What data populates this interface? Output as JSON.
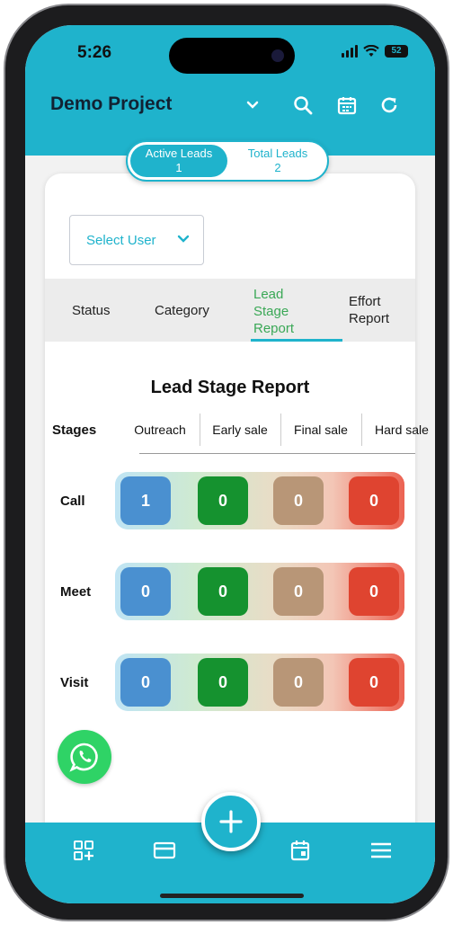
{
  "status_bar": {
    "time": "5:26",
    "battery": "52"
  },
  "header": {
    "title": "Demo Project"
  },
  "lead_toggle": {
    "active": {
      "label": "Active Leads",
      "count": "1"
    },
    "total": {
      "label": "Total Leads",
      "count": "2"
    }
  },
  "user_select": {
    "placeholder": "Select User"
  },
  "tabs": [
    {
      "label": "Status",
      "active": false
    },
    {
      "label": "Category",
      "active": false
    },
    {
      "label": "Lead Stage Report",
      "active": true
    },
    {
      "label": "Effort Report",
      "active": false
    }
  ],
  "report": {
    "title": "Lead Stage Report",
    "row_header": "Stages",
    "columns": [
      "Outreach",
      "Early sale",
      "Final sale",
      "Hard sale"
    ],
    "rows": [
      {
        "stage": "Call",
        "values": [
          "1",
          "0",
          "0",
          "0"
        ]
      },
      {
        "stage": "Meet",
        "values": [
          "0",
          "0",
          "0",
          "0"
        ]
      },
      {
        "stage": "Visit",
        "values": [
          "0",
          "0",
          "0",
          "0"
        ]
      }
    ],
    "column_colors": [
      "#4a90d0",
      "#15922f",
      "#b89677",
      "#df4430"
    ]
  },
  "colors": {
    "primary": "#1fb3cc",
    "active_tab": "#3aa856",
    "whatsapp": "#2fd366"
  }
}
